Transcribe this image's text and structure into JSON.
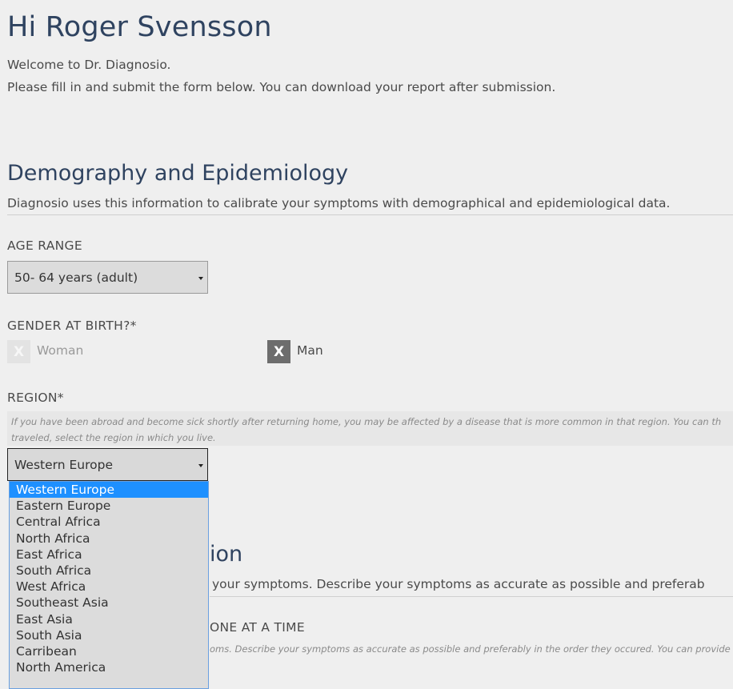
{
  "header": {
    "greeting": "Hi Roger Svensson",
    "welcome": "Welcome to Dr. Diagnosio.",
    "instructions": "Please fill in and submit the form below. You can download your report after submission."
  },
  "demography": {
    "title": "Demography and Epidemiology",
    "description": "Diagnosio uses this information to calibrate your symptoms with demographical and epidemiological data.",
    "age_range": {
      "label": "AGE RANGE",
      "value": "50- 64 years (adult)"
    },
    "gender": {
      "label": "GENDER AT BIRTH?*",
      "options": [
        {
          "label": "Woman",
          "checked": false,
          "mark": "X"
        },
        {
          "label": "Man",
          "checked": true,
          "mark": "X"
        }
      ]
    },
    "region": {
      "label": "REGION*",
      "hint_line1": "If you have been abroad and become sick shortly after returning home, you may be affected by a disease that is more common in that region. You can th",
      "hint_line2": "traveled, select the region in which you live.",
      "value": "Western Europe",
      "options": [
        "Western Europe",
        "Eastern Europe",
        "Central Africa",
        "North Africa",
        "East Africa",
        "South Africa",
        "West Africa",
        "Southeast Asia",
        "East Asia",
        "South Asia",
        "Carribean",
        "North America"
      ],
      "selected_index": 0
    }
  },
  "symptoms_partial": {
    "title_fragment": "ion",
    "description_fragment": "your symptoms. Describe your symptoms as accurate as possible and preferab",
    "label_fragment": "ONE AT A TIME",
    "hint_fragment": "oms. Describe your symptoms as accurate as possible and preferably in the order they occured. You can provide"
  },
  "colors": {
    "heading": "#2f4360",
    "background": "#efefef",
    "dropdown_highlight": "#1e90ff"
  }
}
